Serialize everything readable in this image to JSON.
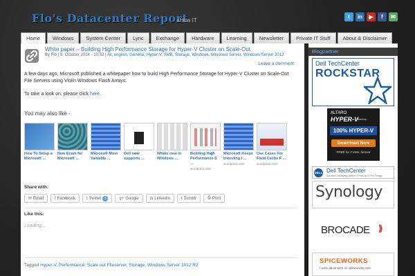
{
  "site": {
    "title": "Flo's Datacenter Report",
    "tagline": "»How IT"
  },
  "social": [
    {
      "icon": "twitter-icon",
      "glyph": "t",
      "color": "#3aa3d8"
    },
    {
      "icon": "linkedin-icon",
      "glyph": "in",
      "color": "#2a6fb0"
    },
    {
      "icon": "youtube-icon",
      "glyph": "▶",
      "color": "#c0302a"
    },
    {
      "icon": "facebook-icon",
      "glyph": "f",
      "color": "#3b5998"
    },
    {
      "icon": "email-icon",
      "glyph": "✉",
      "color": "#58a868"
    }
  ],
  "nav": [
    "Home",
    "Windows",
    "System Center",
    "Lync",
    "Exchange",
    "Hardware",
    "Learning",
    "Newsletter",
    "Private IT Stuff",
    "About & Disclaimer"
  ],
  "post": {
    "title": "White paper – Building High Performance Storage for Hyper-V Cluster on Scale-Out",
    "meta_by": "By",
    "meta_author": "Flo",
    "meta_date": "| 9. October 2014 - 10:33 |",
    "meta_cats": "All, english, General, Hyper-V, SMB, Storage, Windows, Windows Server, Windows Server 2012",
    "leave_comment": "Leave a comment",
    "para1": "A few days ago, Microsoft published a whitepaper how to build High Performance Storage for Hyper-V Cluster on Scale-Out File Servers using Violin Windows Flash Arrays.",
    "para2_prefix": "To take a look on, please click",
    "para2_link": "here",
    "para2_suffix": "."
  },
  "also_like": "You may also like -",
  "related": [
    {
      "title": "How To Setup a Microsoft ...",
      "source": ""
    },
    {
      "title": "New Exam for Microsoft ...",
      "source": ""
    },
    {
      "title": "Microsoft Most Valuable ...",
      "source": ""
    },
    {
      "title": "Dell now supports ...",
      "source": ""
    },
    {
      "title": "Whats new in Windows ...",
      "source": ""
    },
    {
      "title": "Building High Performance S ...",
      "source": "wordpress.com"
    },
    {
      "title": "Microsoft Keeps Investing I ...",
      "source": "wordpress.com"
    },
    {
      "title": "Use Cases For Fluid Cache F ...",
      "source": "wordpress.com"
    }
  ],
  "share": {
    "heading": "Share with:",
    "buttons": [
      {
        "name": "email",
        "label": "Email",
        "glyph": "✉"
      },
      {
        "name": "facebook",
        "label": "Facebook",
        "glyph": "f"
      },
      {
        "name": "twitter",
        "label": "Twitter",
        "glyph": "t",
        "count": "1"
      },
      {
        "name": "google",
        "label": "Google",
        "glyph": "g+"
      },
      {
        "name": "linkedin",
        "label": "LinkedIn",
        "glyph": "in"
      },
      {
        "name": "tumblr",
        "label": "Tumblr",
        "glyph": "t"
      },
      {
        "name": "print",
        "label": "Print",
        "glyph": "⎙"
      }
    ]
  },
  "like": {
    "heading": "Like this:",
    "loading": "Loading..."
  },
  "tags": {
    "prefix": "Tagged",
    "items": "Hyper-V, Performance, Scale out Fileserver, Storage, Windows Server 2012 R2"
  },
  "sidebar": {
    "heading": "Blogpartner",
    "dell_rockstar": {
      "line1": "Dell TechCenter",
      "line2": "ROCKSTAR"
    },
    "altaro": {
      "brand": "ALTARO",
      "product": "HYPER-V",
      "product_sub": "Backup",
      "badge": "100% HYPER-V",
      "button": "Download Now",
      "free": "FREE for 2 VMs, forever"
    },
    "dell_tc": {
      "line1": "Dell TechCenter",
      "line2": "Join the Community where IT Pros do IT Pro Things"
    },
    "synology": "Synology",
    "brocade": "BROCADE",
    "spiceworks": {
      "name": "SPICEWORKS",
      "sub": "I write about tech on spiceworks.com"
    }
  }
}
